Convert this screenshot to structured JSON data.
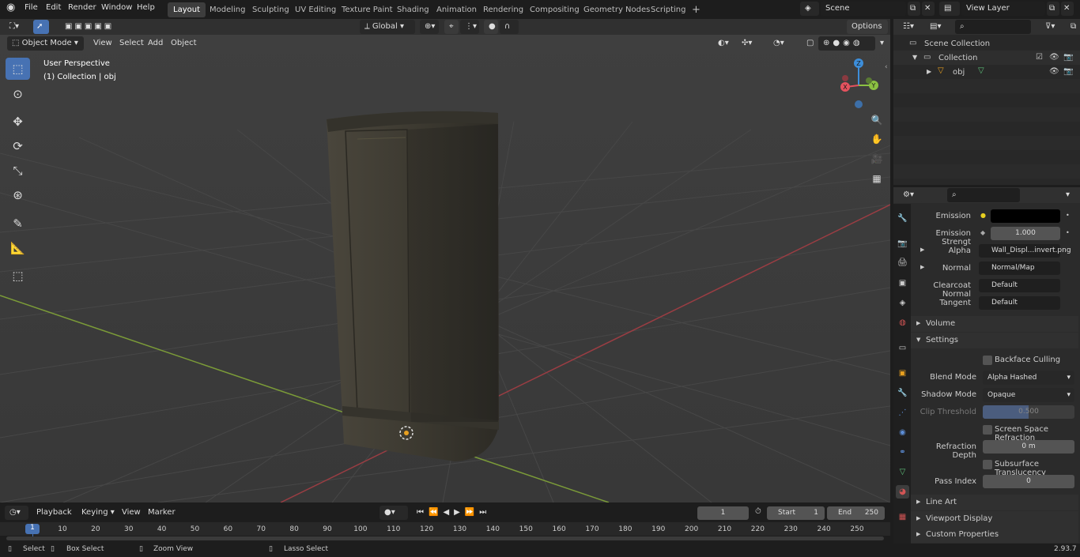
{
  "menus": [
    "File",
    "Edit",
    "Render",
    "Window",
    "Help"
  ],
  "workspaces": [
    "Layout",
    "Modeling",
    "Sculpting",
    "UV Editing",
    "Texture Paint",
    "Shading",
    "Animation",
    "Rendering",
    "Compositing",
    "Geometry Nodes",
    "Scripting"
  ],
  "scene": "Scene",
  "view_layer": "View Layer",
  "toolbar": {
    "transform_orientation": "Global",
    "options_label": "Options"
  },
  "viewport": {
    "mode": "Object Mode",
    "menus": [
      "View",
      "Select",
      "Add",
      "Object"
    ],
    "info_line1": "User Perspective",
    "info_line2": "(1) Collection | obj",
    "gizmo_axes": {
      "x": "X",
      "y": "Y",
      "z": "Z"
    }
  },
  "outliner": {
    "root": "Scene Collection",
    "collection": "Collection",
    "object": "obj"
  },
  "properties": {
    "rows": [
      {
        "label": "Emission",
        "value": "",
        "type": "color"
      },
      {
        "label": "Emission Strengt",
        "value": "1.000",
        "type": "num"
      },
      {
        "label": "Alpha",
        "value": "Wall_Displ...invert.png",
        "type": "link"
      },
      {
        "label": "Normal",
        "value": "Normal/Map",
        "type": "link"
      },
      {
        "label": "Clearcoat Normal",
        "value": "Default",
        "type": "link"
      },
      {
        "label": "Tangent",
        "value": "Default",
        "type": "link"
      }
    ],
    "sections": {
      "volume": "Volume",
      "settings": "Settings",
      "line_art": "Line Art",
      "viewport_display": "Viewport Display",
      "custom_properties": "Custom Properties"
    },
    "settings": {
      "backface_culling": "Backface Culling",
      "blend_mode_label": "Blend Mode",
      "blend_mode": "Alpha Hashed",
      "shadow_mode_label": "Shadow Mode",
      "shadow_mode": "Opaque",
      "clip_threshold_label": "Clip Threshold",
      "clip_threshold": "0.500",
      "ssr": "Screen Space Refraction",
      "refraction_depth_label": "Refraction Depth",
      "refraction_depth": "0 m",
      "subsurface": "Subsurface Translucency",
      "pass_index_label": "Pass Index",
      "pass_index": "0"
    }
  },
  "timeline": {
    "menus": [
      "Playback",
      "Keying",
      "View",
      "Marker"
    ],
    "current_frame": "1",
    "start_label": "Start",
    "start": "1",
    "end_label": "End",
    "end": "250",
    "frame_ticks": [
      "1",
      "10",
      "20",
      "30",
      "40",
      "50",
      "60",
      "70",
      "80",
      "90",
      "100",
      "110",
      "120",
      "130",
      "140",
      "150",
      "160",
      "170",
      "180",
      "190",
      "200",
      "210",
      "220",
      "230",
      "240",
      "250"
    ]
  },
  "status": {
    "select": "Select",
    "box_select": "Box Select",
    "zoom_view": "Zoom View",
    "lasso_select": "Lasso Select",
    "version": "2.93.7"
  },
  "colors": {
    "accent": "#4772b3",
    "active_frame": "#4772b3",
    "x_axis": "#e5525e",
    "y_axis": "#8bc142",
    "z_axis": "#3d8eda"
  }
}
